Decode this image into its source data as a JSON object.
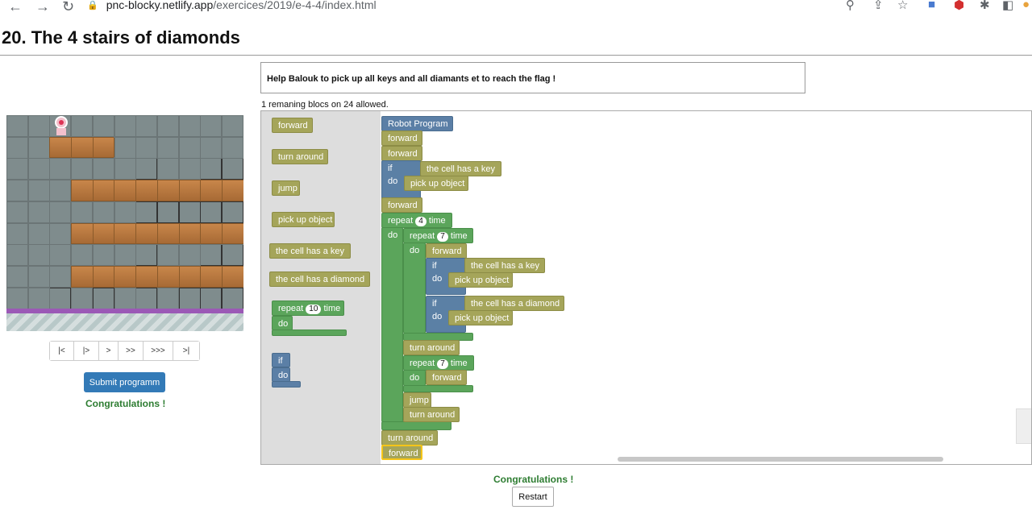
{
  "browser": {
    "url_host": "pnc-blocky.netlify.app",
    "url_path": "/exercices/2019/e-4-4/index.html"
  },
  "page_title": "20. The 4 stairs of diamonds",
  "stepper": {
    "buttons": [
      "|<",
      "|>",
      ">",
      ">>",
      ">>>",
      ">|"
    ]
  },
  "left_panel": {
    "submit_label": "Submit programm",
    "congrats": "Congratulations !"
  },
  "instruction": "Help Balouk to pick up all keys and all diamants et to reach the flag !",
  "remaining": "1 remaning blocs on 24 allowed.",
  "toolbox": {
    "forward": "forward",
    "turn_around": "turn around",
    "jump": "jump",
    "pick_up": "pick up object",
    "cell_key": "the cell has a key",
    "cell_diamond": "the cell has a diamond",
    "repeat": "repeat",
    "repeat_count": "10",
    "time": "time",
    "do": "do",
    "if": "if"
  },
  "program": {
    "root": "Robot Program",
    "forward": "forward",
    "turn_around": "turn around",
    "jump": "jump",
    "pick_up": "pick up object",
    "cell_key": "the cell has a key",
    "cell_diamond": "the cell has a diamond",
    "repeat": "repeat",
    "time": "time",
    "do": "do",
    "if": "if",
    "outer_repeat_count": "4",
    "inner_repeat_count": "7",
    "second_repeat_count": "7"
  },
  "bottom": {
    "congrats": "Congratulations !",
    "restart_label": "Restart"
  }
}
